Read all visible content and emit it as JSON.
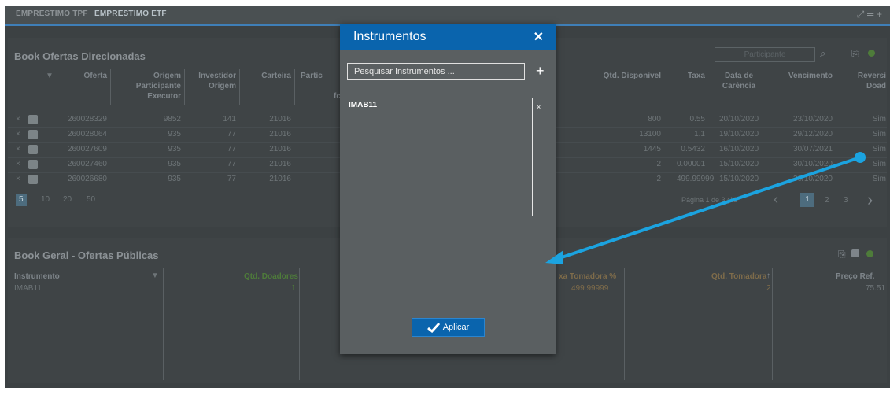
{
  "tabs": [
    "EMPRESTIMO TPF",
    "EMPRESTIMO ETF"
  ],
  "tab_icons": "⤢ ☰ +",
  "book_direcionadas": {
    "title": "Book Ofertas Direcionadas",
    "participant_placeholder": "Participante",
    "columns": [
      "Oferta",
      "Origem Participante Executor",
      "Investidor Origem",
      "Carteira",
      "Partic",
      "Qtd. Disponivel",
      "Taxa",
      "Data de Carência",
      "Vencimento",
      "Reversi Doad"
    ],
    "partial_f": "fc",
    "rows": [
      {
        "oferta": "260028329",
        "origem": "9852",
        "investidor": "141",
        "carteira": "21016",
        "qtd": "800",
        "taxa": "0.55",
        "carencia": "20/10/2020",
        "vencimento": "23/10/2020",
        "rev": "Sim"
      },
      {
        "oferta": "260028064",
        "origem": "935",
        "investidor": "77",
        "carteira": "21016",
        "qtd": "13100",
        "taxa": "1.1",
        "carencia": "19/10/2020",
        "vencimento": "29/12/2020",
        "rev": "Sim"
      },
      {
        "oferta": "260027609",
        "origem": "935",
        "investidor": "77",
        "carteira": "21016",
        "qtd": "1445",
        "taxa": "0.5432",
        "carencia": "16/10/2020",
        "vencimento": "30/07/2021",
        "rev": "Sim"
      },
      {
        "oferta": "260027460",
        "origem": "935",
        "investidor": "77",
        "carteira": "21016",
        "qtd": "2",
        "taxa": "0.00001",
        "carencia": "15/10/2020",
        "vencimento": "30/10/2020",
        "rev": "Sim"
      },
      {
        "oferta": "260026680",
        "origem": "935",
        "investidor": "77",
        "carteira": "21016",
        "qtd": "2",
        "taxa": "499.99999",
        "carencia": "15/10/2020",
        "vencimento": "30/10/2020",
        "rev": "Sim"
      }
    ],
    "page_sizes": [
      "5",
      "10",
      "20",
      "50"
    ],
    "pager_text": "Página 1 de 3 (12",
    "pages": [
      "1",
      "2",
      "3"
    ]
  },
  "book_geral": {
    "title": "Book Geral - Ofertas Públicas",
    "col_instrumento": "Instrumento",
    "col_qtd_doadores": "Qtd. Doadores",
    "col_taxa_tomadora": "xa Tomadora %",
    "col_qtd_tomadora": "Qtd. Tomadora",
    "col_preco": "Preço Ref.",
    "row": {
      "instrumento": "IMAB11",
      "qtd_doadores": "1",
      "taxa_tomadora": "499.99999",
      "qtd_tomadora": "2",
      "preco": "75.51"
    }
  },
  "dialog": {
    "title": "Instrumentos",
    "close": "✕",
    "search_placeholder": "Pesquisar Instrumentos ...",
    "add": "+",
    "items": [
      "IMAB11"
    ],
    "remove": "×",
    "apply_label": "Aplicar"
  },
  "colors": {
    "accent": "#0a64ad",
    "overlay": "#3c4143",
    "arrow": "#1ba3e0"
  }
}
